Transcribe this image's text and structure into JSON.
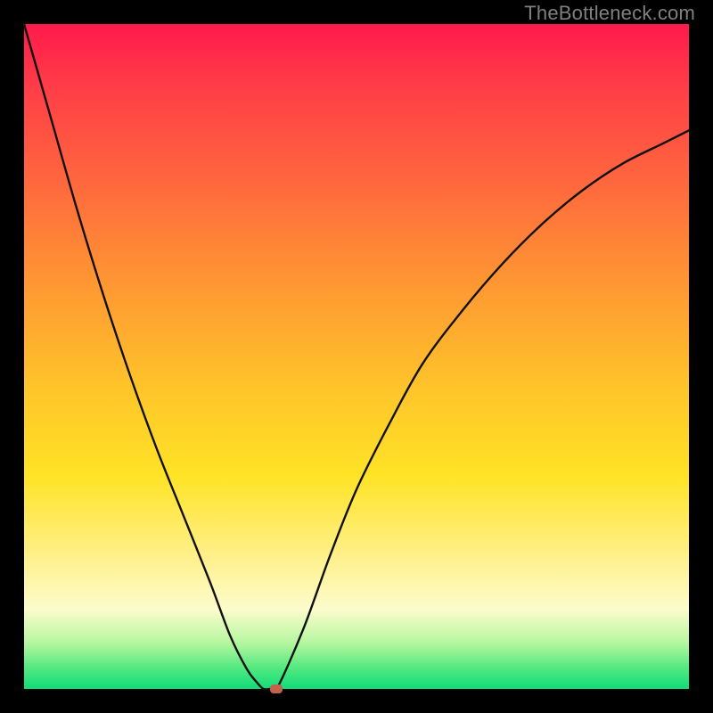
{
  "watermark": "TheBottleneck.com",
  "chart_data": {
    "type": "line",
    "title": "",
    "xlabel": "",
    "ylabel": "",
    "xlim": [
      0,
      100
    ],
    "ylim": [
      0,
      100
    ],
    "series": [
      {
        "name": "curve",
        "x": [
          0,
          4,
          8,
          12,
          16,
          20,
          24,
          28,
          31,
          33.5,
          35,
          36,
          37,
          38,
          42,
          46,
          50,
          55,
          60,
          66,
          72,
          78,
          84,
          90,
          96,
          100
        ],
        "y": [
          100,
          86,
          72,
          59,
          47,
          36,
          26,
          16,
          8,
          3,
          1,
          0,
          0,
          0,
          9,
          20,
          30,
          40,
          49,
          57,
          64,
          70,
          75,
          79,
          82,
          84
        ]
      }
    ],
    "flat_segment": {
      "from_x": 35,
      "to_x": 38,
      "y": 0
    },
    "marker": {
      "x": 38,
      "y": 0,
      "color": "#c1624e"
    },
    "background": {
      "type": "vertical-gradient",
      "stops": [
        {
          "pos": 0,
          "color": "#ff1a4b"
        },
        {
          "pos": 25,
          "color": "#ff6b3d"
        },
        {
          "pos": 55,
          "color": "#ffc52a"
        },
        {
          "pos": 80,
          "color": "#fff08a"
        },
        {
          "pos": 100,
          "color": "#11dc7a"
        }
      ]
    }
  }
}
